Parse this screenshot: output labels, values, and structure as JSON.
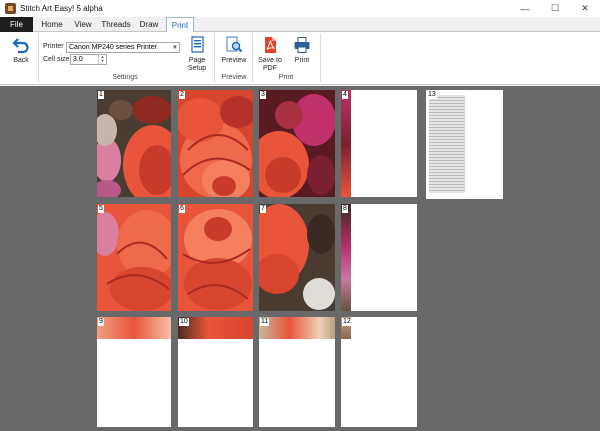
{
  "window": {
    "title": "Stitch Art Easy! 5 alpha",
    "minimize": "—",
    "maximize": "☐",
    "close": "✕"
  },
  "menu": {
    "file": "File",
    "tabs": [
      "Home",
      "View",
      "Threads",
      "Draw",
      "Print"
    ],
    "active_tab": "Print"
  },
  "ribbon": {
    "back_label": "Back",
    "printer_label": "Printer",
    "printer_value": "Canon MP240 series Printer",
    "cell_size_label": "Cell size",
    "cell_size_value": "3.0",
    "page_setup_label": "Page\nSetup",
    "settings_group": "Settings",
    "preview_label": "Preview",
    "preview_group": "Preview",
    "save_pdf_label": "Save to\nPDF",
    "print_label": "Print",
    "print_group": "Print"
  },
  "pages": [
    "1",
    "2",
    "3",
    "4",
    "5",
    "6",
    "7",
    "8",
    "9",
    "10",
    "11",
    "12",
    "13"
  ],
  "colors": {
    "canvas_bg": "#696969",
    "accent": "#1b68c5",
    "rose_main": "#e8553a",
    "rose_dark": "#a0201c",
    "pdf_red": "#e0452a"
  },
  "icons": {
    "back": "back-arrow-icon",
    "page_setup": "page-setup-icon",
    "preview": "magnifier-page-icon",
    "pdf": "pdf-icon",
    "print": "printer-icon"
  }
}
